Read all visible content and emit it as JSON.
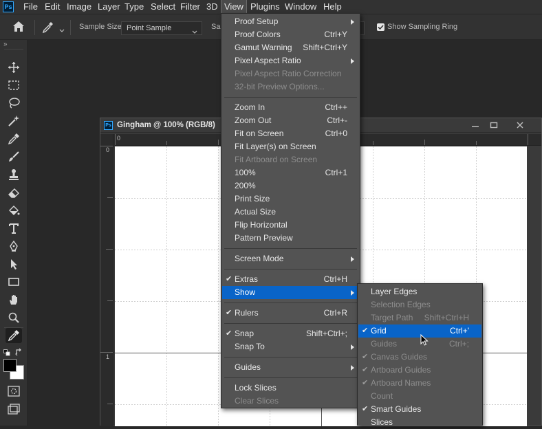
{
  "menubar": {
    "logo": "Ps",
    "items": [
      "File",
      "Edit",
      "Image",
      "Layer",
      "Type",
      "Select",
      "Filter",
      "3D",
      "View",
      "Plugins",
      "Window",
      "Help"
    ]
  },
  "options": {
    "sample_size_label": "Sample Size:",
    "sample_size_value": "Point Sample",
    "sample_label_partial": "Sar",
    "show_ring_label": "Show Sampling Ring"
  },
  "document": {
    "title": "Gingham @ 100% (RGB/8)",
    "ruler_top_zero": "0",
    "ruler_left_zero": "0",
    "ruler_left_one": "1"
  },
  "view_menu": {
    "groups": [
      [
        {
          "label": "Proof Setup",
          "shortcut": "",
          "submenu": true
        },
        {
          "label": "Proof Colors",
          "shortcut": "Ctrl+Y"
        },
        {
          "label": "Gamut Warning",
          "shortcut": "Shift+Ctrl+Y"
        },
        {
          "label": "Pixel Aspect Ratio",
          "shortcut": "",
          "submenu": true
        },
        {
          "label": "Pixel Aspect Ratio Correction",
          "shortcut": "",
          "disabled": true
        },
        {
          "label": "32-bit Preview Options...",
          "shortcut": "",
          "disabled": true
        }
      ],
      [
        {
          "label": "Zoom In",
          "shortcut": "Ctrl++"
        },
        {
          "label": "Zoom Out",
          "shortcut": "Ctrl+-"
        },
        {
          "label": "Fit on Screen",
          "shortcut": "Ctrl+0"
        },
        {
          "label": "Fit Layer(s) on Screen",
          "shortcut": ""
        },
        {
          "label": "Fit Artboard on Screen",
          "shortcut": "",
          "disabled": true
        },
        {
          "label": "100%",
          "shortcut": "Ctrl+1"
        },
        {
          "label": "200%",
          "shortcut": ""
        },
        {
          "label": "Print Size",
          "shortcut": ""
        },
        {
          "label": "Actual Size",
          "shortcut": ""
        },
        {
          "label": "Flip Horizontal",
          "shortcut": ""
        },
        {
          "label": "Pattern Preview",
          "shortcut": ""
        }
      ],
      [
        {
          "label": "Screen Mode",
          "shortcut": "",
          "submenu": true
        }
      ],
      [
        {
          "label": "Extras",
          "shortcut": "Ctrl+H",
          "checked": true
        },
        {
          "label": "Show",
          "shortcut": "",
          "submenu": true,
          "highlighted": true
        }
      ],
      [
        {
          "label": "Rulers",
          "shortcut": "Ctrl+R",
          "checked": true
        }
      ],
      [
        {
          "label": "Snap",
          "shortcut": "Shift+Ctrl+;",
          "checked": true
        },
        {
          "label": "Snap To",
          "shortcut": "",
          "submenu": true
        }
      ],
      [
        {
          "label": "Guides",
          "shortcut": "",
          "submenu": true
        }
      ],
      [
        {
          "label": "Lock Slices",
          "shortcut": ""
        },
        {
          "label": "Clear Slices",
          "shortcut": "",
          "disabled": true
        }
      ]
    ]
  },
  "show_submenu": {
    "items": [
      {
        "label": "Layer Edges",
        "shortcut": ""
      },
      {
        "label": "Selection Edges",
        "shortcut": "",
        "disabled": true
      },
      {
        "label": "Target Path",
        "shortcut": "Shift+Ctrl+H",
        "disabled": true
      },
      {
        "label": "Grid",
        "shortcut": "Ctrl+'",
        "checked": true,
        "highlighted": true
      },
      {
        "label": "Guides",
        "shortcut": "Ctrl+;",
        "disabled": true
      },
      {
        "label": "Canvas Guides",
        "shortcut": "",
        "checked": true,
        "disabled": true
      },
      {
        "label": "Artboard Guides",
        "shortcut": "",
        "checked": true,
        "disabled": true
      },
      {
        "label": "Artboard Names",
        "shortcut": "",
        "checked": true,
        "disabled": true
      },
      {
        "label": "Count",
        "shortcut": "",
        "disabled": true
      },
      {
        "label": "Smart Guides",
        "shortcut": "",
        "checked": true
      },
      {
        "label": "Slices",
        "shortcut": ""
      }
    ]
  },
  "colors": {
    "highlight": "#0964c8",
    "menu_bg": "#535353",
    "app_bg": "#282828",
    "canvas": "#ffffff"
  },
  "tool_icons": [
    "move-icon",
    "marquee-icon",
    "lasso-icon",
    "magic-wand-icon",
    "eyedropper-icon",
    "brush-icon",
    "stamp-icon",
    "eraser-icon",
    "paint-bucket-icon",
    "type-icon",
    "pen-icon",
    "path-select-icon",
    "rectangle-icon",
    "hand-icon",
    "zoom-icon",
    "eyedropper-active-icon"
  ]
}
